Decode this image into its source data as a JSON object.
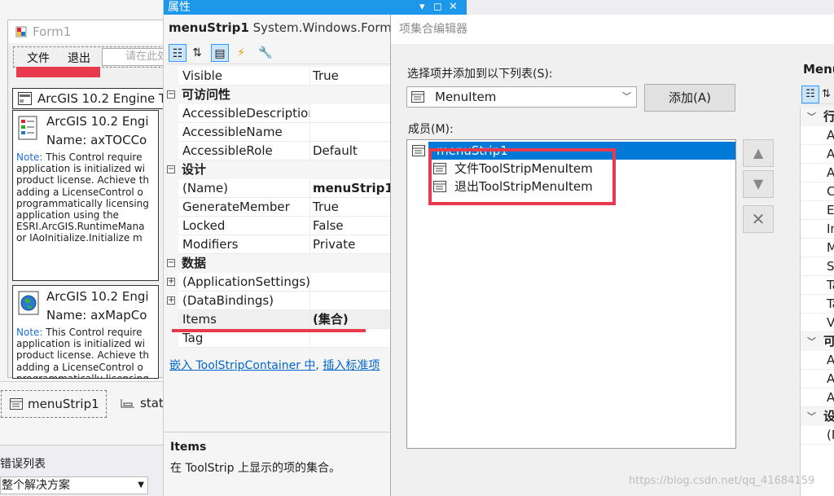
{
  "designer": {
    "form_title": "Form1",
    "menu": {
      "file": "文件",
      "exit": "退出",
      "type_here": "请在此处键入"
    },
    "arcgis_tab": "ArcGIS 10.2 Engine T",
    "license1": {
      "title": "ArcGIS 10.2 Engi",
      "name": "Name: axTOCCo",
      "note_label": "Note:",
      "note": " This Control require\napplication is initialized wi\nproduct license. Achieve th\nadding a LicenseControl o\nprogrammatically licensing\napplication using the\nESRI.ArcGIS.RuntimeMana\nor IAoInitialize.Initialize m"
    },
    "license2": {
      "title": "ArcGIS 10.2 Engi",
      "name": "Name: axMapCo",
      "note_label": "Note:",
      "note": " This Control require\napplication is initialized wi\nproduct license. Achieve th\nadding a LicenseControl o\nprogrammatically licensing"
    },
    "tray": {
      "menustrip": "menuStrip1",
      "statusstrip": "stat"
    },
    "errlist": {
      "title": "错误列表",
      "scope": "整个解决方案"
    }
  },
  "props": {
    "title": "属性",
    "object_name": "menuStrip1",
    "object_type": "System.Windows.Forms.MenuStrip",
    "rows": {
      "visible": {
        "name": "Visible",
        "value": "True"
      },
      "cat_access": "可访问性",
      "acc_desc": {
        "name": "AccessibleDescription",
        "value": ""
      },
      "acc_name": {
        "name": "AccessibleName",
        "value": ""
      },
      "acc_role": {
        "name": "AccessibleRole",
        "value": "Default"
      },
      "cat_design": "设计",
      "name": {
        "name": "(Name)",
        "value": "menuStrip1"
      },
      "genmember": {
        "name": "GenerateMember",
        "value": "True"
      },
      "locked": {
        "name": "Locked",
        "value": "False"
      },
      "modifiers": {
        "name": "Modifiers",
        "value": "Private"
      },
      "cat_data": "数据",
      "appsettings": {
        "name": "(ApplicationSettings)",
        "value": ""
      },
      "databindings": {
        "name": "(DataBindings)",
        "value": ""
      },
      "items": {
        "name": "Items",
        "value": "(集合)"
      },
      "tag": {
        "name": "Tag",
        "value": ""
      }
    },
    "link1": "嵌入 ToolStripContainer 中",
    "link_sep": ", ",
    "link2": "插入标准项",
    "desc_title": "Items",
    "desc_text": "在 ToolStrip 上显示的项的集合。"
  },
  "editor": {
    "title": "项集合编辑器",
    "choose_label": "选择项并添加到以下列表(S):",
    "type_value": "MenuItem",
    "add_button": "添加(A)",
    "members_label": "成员(M):",
    "members": [
      "menuStrip1",
      "文件ToolStripMenuItem",
      "退出ToolStripMenuItem"
    ],
    "right_title": "Menu",
    "right_rows": {
      "c1": "行",
      "r1": "A",
      "r2": "A",
      "r3": "A",
      "r4": "Co",
      "r5": "Er",
      "r6": "In",
      "r7": "M",
      "r8": "Sh",
      "r9": "Ta",
      "r10": "Ta",
      "r11": "Vi",
      "c2": "可",
      "r12": "A",
      "r13": "A",
      "r14": "A",
      "c3": "设",
      "r15": "(N"
    }
  },
  "watermark": "https://blog.csdn.net/qq_41684159",
  "colors": {
    "accent": "#1c97ea",
    "selection": "#0078d7",
    "annotation_red": "#e8394d"
  }
}
